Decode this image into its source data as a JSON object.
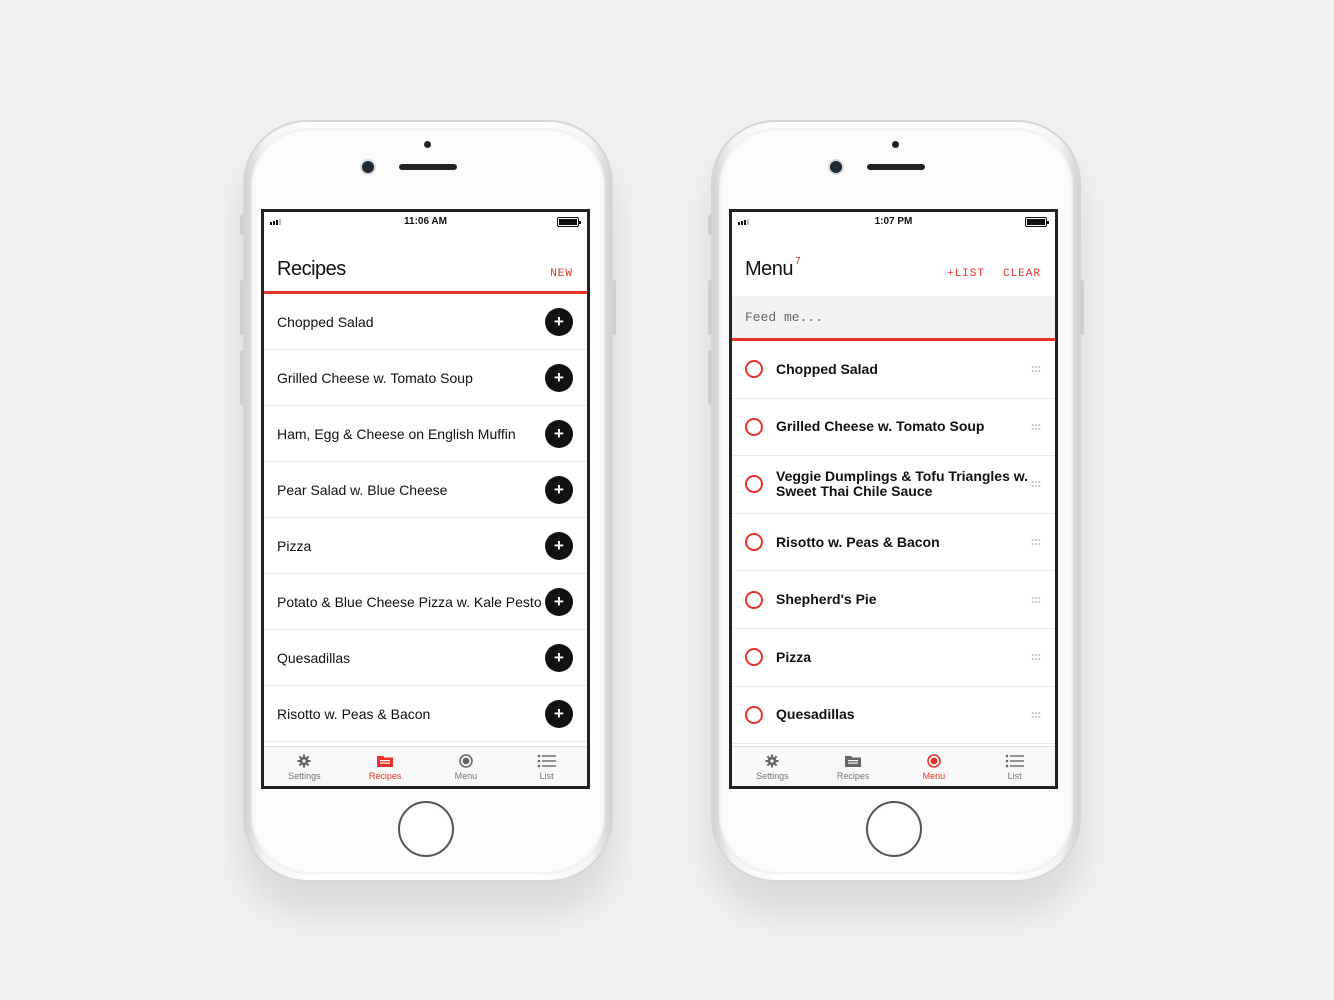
{
  "colors": {
    "accent": "#e8332a",
    "text": "#111111",
    "muted": "#777777"
  },
  "recipes_screen": {
    "status_time": "11:06 AM",
    "title": "Recipes",
    "new_label": "NEW",
    "items": [
      {
        "label": "Chopped Salad"
      },
      {
        "label": "Grilled Cheese w. Tomato Soup"
      },
      {
        "label": "Ham, Egg & Cheese on English Muffin"
      },
      {
        "label": "Pear Salad w. Blue Cheese"
      },
      {
        "label": "Pizza"
      },
      {
        "label": "Potato & Blue Cheese Pizza w. Kale Pesto"
      },
      {
        "label": "Quesadillas"
      },
      {
        "label": "Risotto w. Peas & Bacon"
      }
    ],
    "tabs": [
      {
        "label": "Settings",
        "icon": "gear-icon"
      },
      {
        "label": "Recipes",
        "icon": "folder-icon",
        "active": true
      },
      {
        "label": "Menu",
        "icon": "target-icon"
      },
      {
        "label": "List",
        "icon": "list-icon"
      }
    ]
  },
  "menu_screen": {
    "status_time": "1:07 PM",
    "title": "Menu",
    "count": "7",
    "add_list_label": "+LIST",
    "clear_label": "CLEAR",
    "search_placeholder": "Feed me...",
    "items": [
      {
        "label": "Chopped Salad"
      },
      {
        "label": "Grilled Cheese w. Tomato Soup"
      },
      {
        "label": "Veggie Dumplings & Tofu Triangles w. Sweet Thai Chile Sauce"
      },
      {
        "label": "Risotto w. Peas & Bacon"
      },
      {
        "label": "Shepherd's Pie"
      },
      {
        "label": "Pizza"
      },
      {
        "label": "Quesadillas"
      }
    ],
    "tabs": [
      {
        "label": "Settings",
        "icon": "gear-icon"
      },
      {
        "label": "Recipes",
        "icon": "folder-icon"
      },
      {
        "label": "Menu",
        "icon": "target-icon",
        "active": true
      },
      {
        "label": "List",
        "icon": "list-icon"
      }
    ]
  }
}
